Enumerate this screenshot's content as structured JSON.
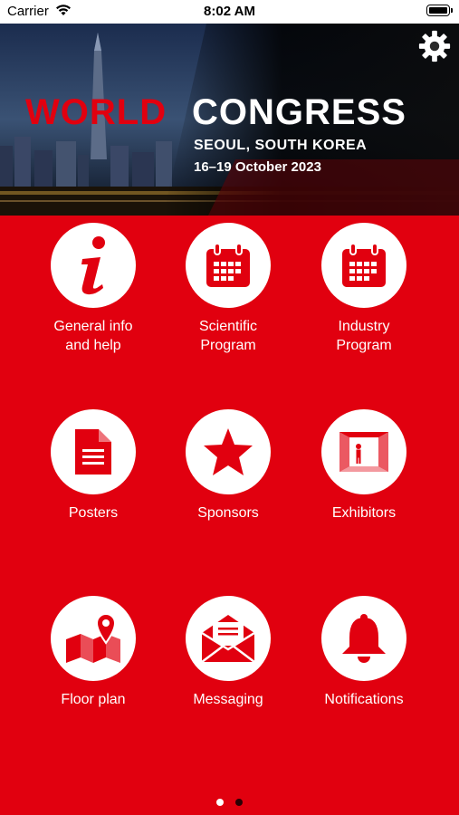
{
  "status_bar": {
    "carrier": "Carrier",
    "time": "8:02 AM"
  },
  "banner": {
    "title_world": "WORLD",
    "title_congress": "CONGRESS",
    "location": "SEOUL, SOUTH KOREA",
    "dates": "16–19 October 2023"
  },
  "tiles": [
    {
      "line1": "General info",
      "line2": "and help",
      "icon": "info-icon"
    },
    {
      "line1": "Scientific",
      "line2": "Program",
      "icon": "calendar-icon"
    },
    {
      "line1": "Industry",
      "line2": "Program",
      "icon": "calendar-icon"
    },
    {
      "line1": "Posters",
      "line2": "",
      "icon": "document-icon"
    },
    {
      "line1": "Sponsors",
      "line2": "",
      "icon": "star-icon"
    },
    {
      "line1": "Exhibitors",
      "line2": "",
      "icon": "booth-icon"
    },
    {
      "line1": "Floor plan",
      "line2": "",
      "icon": "map-pin-icon"
    },
    {
      "line1": "Messaging",
      "line2": "",
      "icon": "envelope-icon"
    },
    {
      "line1": "Notifications",
      "line2": "",
      "icon": "bell-icon"
    }
  ],
  "colors": {
    "brand_red": "#e1000f",
    "white": "#ffffff"
  },
  "pagination": {
    "count": 2,
    "active": 0
  }
}
